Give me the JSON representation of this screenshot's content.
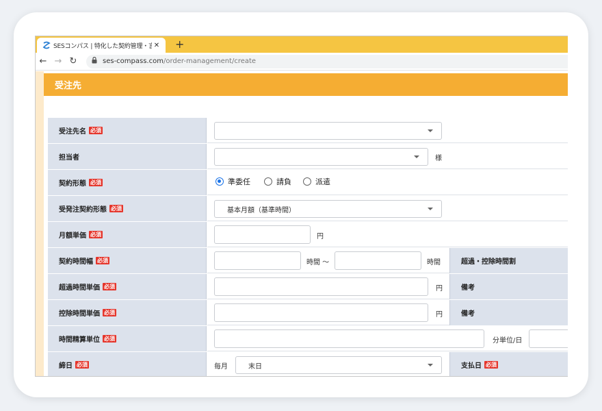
{
  "browser": {
    "tab_title": "SESコンパス | 特化した契約管理・言",
    "tab_close": "✕",
    "new_tab": "+",
    "url_domain": "ses-compass.com",
    "url_path": "/order-management/create"
  },
  "section": {
    "title": "受注先"
  },
  "required_badge": "必須",
  "rows": {
    "client_name": {
      "label": "受注先名",
      "value": ""
    },
    "contact": {
      "label": "担当者",
      "value": "",
      "suffix": "様"
    },
    "contract_type": {
      "label": "契約形態",
      "options": [
        "準委任",
        "請負",
        "派遣"
      ],
      "selected": "準委任"
    },
    "order_contract_type": {
      "label": "受発注契約形態",
      "value": "基本月額（基準時間）"
    },
    "monthly_price": {
      "label": "月額単価",
      "unit": "円"
    },
    "contract_hours": {
      "label": "契約時間幅",
      "between": "時間 〜",
      "unit": "時間",
      "side_label": "超過・控除時間割"
    },
    "overtime_price": {
      "label": "超過時間単価",
      "unit": "円",
      "side_label": "備考"
    },
    "deduction_price": {
      "label": "控除時間単価",
      "unit": "円",
      "side_label": "備考"
    },
    "time_unit": {
      "label": "時間精算単位",
      "unit": "分単位/日"
    },
    "closing_day": {
      "label": "締日",
      "prefix": "毎月",
      "value": "末日",
      "side_label": "支払日"
    }
  },
  "colors": {
    "accent": "#f5ad33",
    "tabbar": "#f5c542",
    "label_bg": "#dce2ec",
    "required": "#e5352b",
    "radio": "#1a73e8"
  }
}
